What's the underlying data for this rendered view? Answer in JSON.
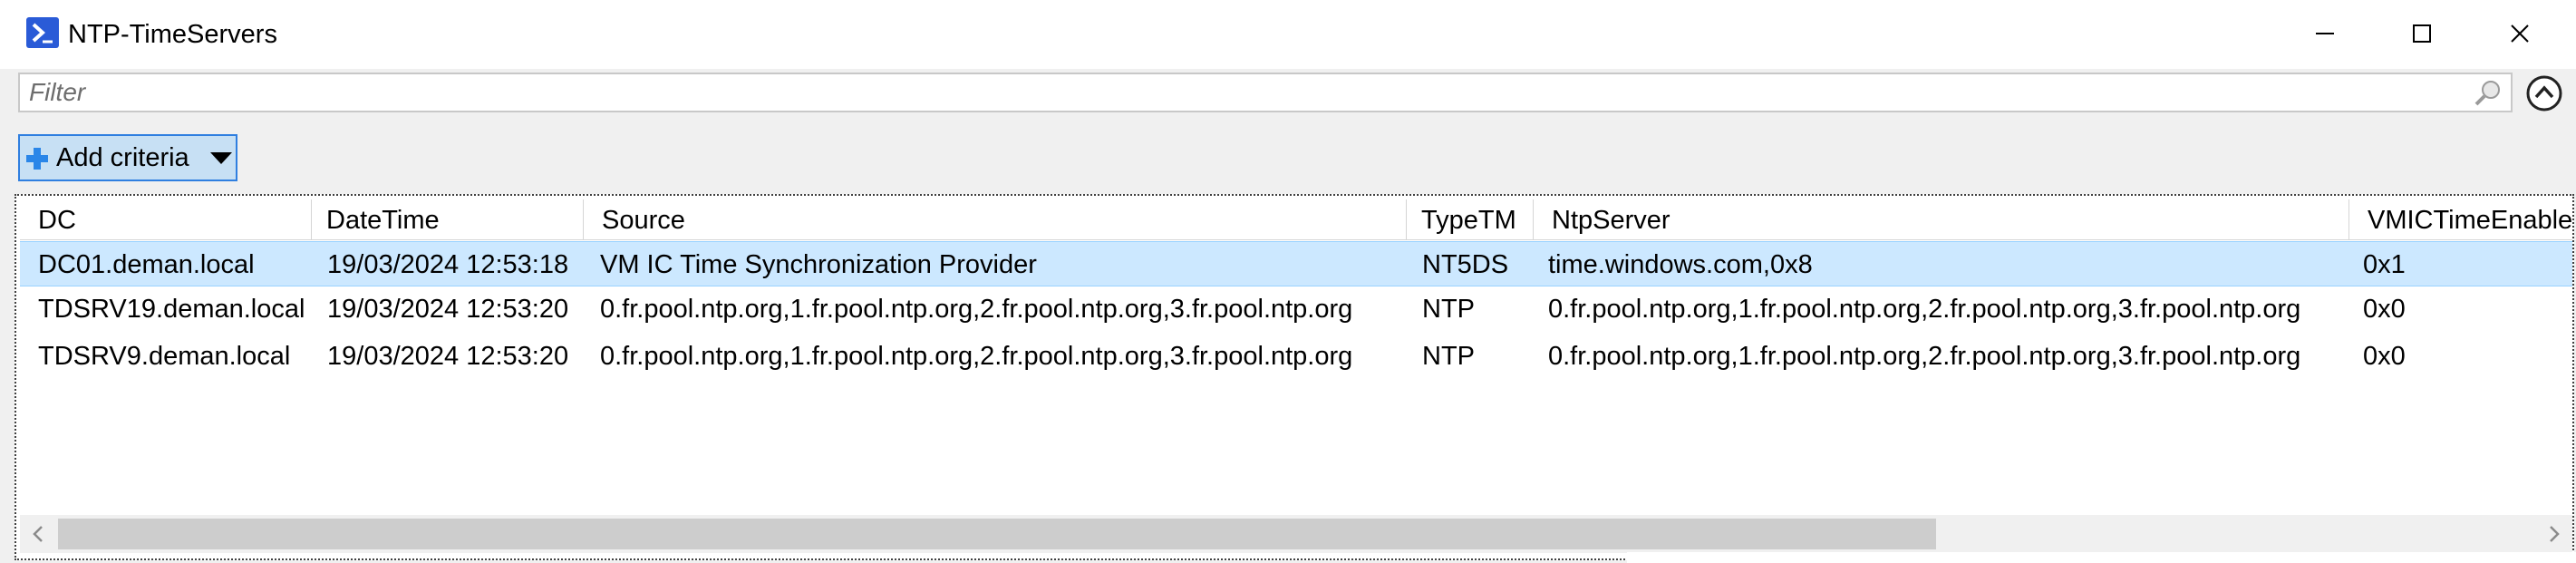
{
  "window": {
    "title": "NTP-TimeServers",
    "icon": "powershell-icon",
    "controls": [
      "minimize-icon",
      "maximize-icon",
      "close-icon"
    ]
  },
  "filter": {
    "placeholder": "Filter",
    "value": "",
    "search_icon": "search-icon",
    "collapse_icon": "chevron-up-circle-icon"
  },
  "criteria": {
    "label": "Add criteria",
    "icon": "plus-icon",
    "caret": "caret-down-icon"
  },
  "columns": [
    "DC",
    "DateTime",
    "Source",
    "TypeTM",
    "NtpServer",
    "VMICTimeEnable"
  ],
  "rows": [
    {
      "dc": "DC01.deman.local",
      "datetime": "19/03/2024 12:53:18",
      "source": "VM IC Time Synchronization Provider",
      "typetm": "NT5DS",
      "ntpserver": "time.windows.com,0x8",
      "vmic": "0x1",
      "selected": true
    },
    {
      "dc": "TDSRV19.deman.local",
      "datetime": "19/03/2024 12:53:20",
      "source": "0.fr.pool.ntp.org,1.fr.pool.ntp.org,2.fr.pool.ntp.org,3.fr.pool.ntp.org",
      "typetm": "NTP",
      "ntpserver": "0.fr.pool.ntp.org,1.fr.pool.ntp.org,2.fr.pool.ntp.org,3.fr.pool.ntp.org",
      "vmic": "0x0",
      "selected": false
    },
    {
      "dc": "TDSRV9.deman.local",
      "datetime": "19/03/2024 12:53:20",
      "source": "0.fr.pool.ntp.org,1.fr.pool.ntp.org,2.fr.pool.ntp.org,3.fr.pool.ntp.org",
      "typetm": "NTP",
      "ntpserver": "0.fr.pool.ntp.org,1.fr.pool.ntp.org,2.fr.pool.ntp.org,3.fr.pool.ntp.org",
      "vmic": "0x0",
      "selected": false
    }
  ],
  "colors": {
    "selection": "#cce8ff",
    "criteria_button": "#c7e0f4",
    "accent": "#2a5bd7"
  }
}
